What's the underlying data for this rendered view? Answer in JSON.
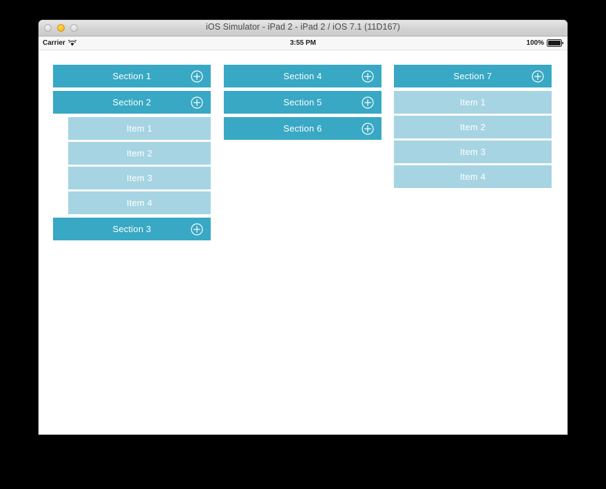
{
  "window": {
    "title": "iOS Simulator - iPad 2 - iPad 2 / iOS 7.1 (11D167)",
    "controls": [
      {
        "name": "close-button",
        "label": "Close",
        "state": "inactive"
      },
      {
        "name": "minimize-button",
        "label": "Minimize",
        "state": "active"
      },
      {
        "name": "zoom-button",
        "label": "Zoom",
        "state": "inactive"
      }
    ]
  },
  "status_bar": {
    "carrier": "Carrier",
    "wifi_icon": "wifi-icon",
    "time": "3:55 PM",
    "battery_percent": "100%",
    "battery_icon": "battery-full-icon"
  },
  "colors": {
    "section_header": "#38a8c4",
    "item_row": "#a6d4e2",
    "text_on_fill": "#ffffff",
    "canvas": "#ffffff",
    "page_background": "#000000"
  },
  "content": {
    "add_icon": "circle-plus-icon",
    "columns": [
      {
        "name": "column-1",
        "sections": [
          {
            "title": "Section 1",
            "expanded": false,
            "items": []
          },
          {
            "title": "Section 2",
            "expanded": true,
            "indented_items": true,
            "items": [
              "Item 1",
              "Item 2",
              "Item 3",
              "Item 4"
            ]
          },
          {
            "title": "Section 3",
            "expanded": false,
            "items": []
          }
        ]
      },
      {
        "name": "column-2",
        "sections": [
          {
            "title": "Section 4",
            "expanded": false,
            "items": []
          },
          {
            "title": "Section 5",
            "expanded": false,
            "items": []
          },
          {
            "title": "Section 6",
            "expanded": false,
            "items": []
          }
        ]
      },
      {
        "name": "column-3",
        "sections": [
          {
            "title": "Section 7",
            "expanded": true,
            "indented_items": false,
            "items": [
              "Item 1",
              "Item 2",
              "Item 3",
              "Item 4"
            ]
          }
        ]
      }
    ]
  }
}
